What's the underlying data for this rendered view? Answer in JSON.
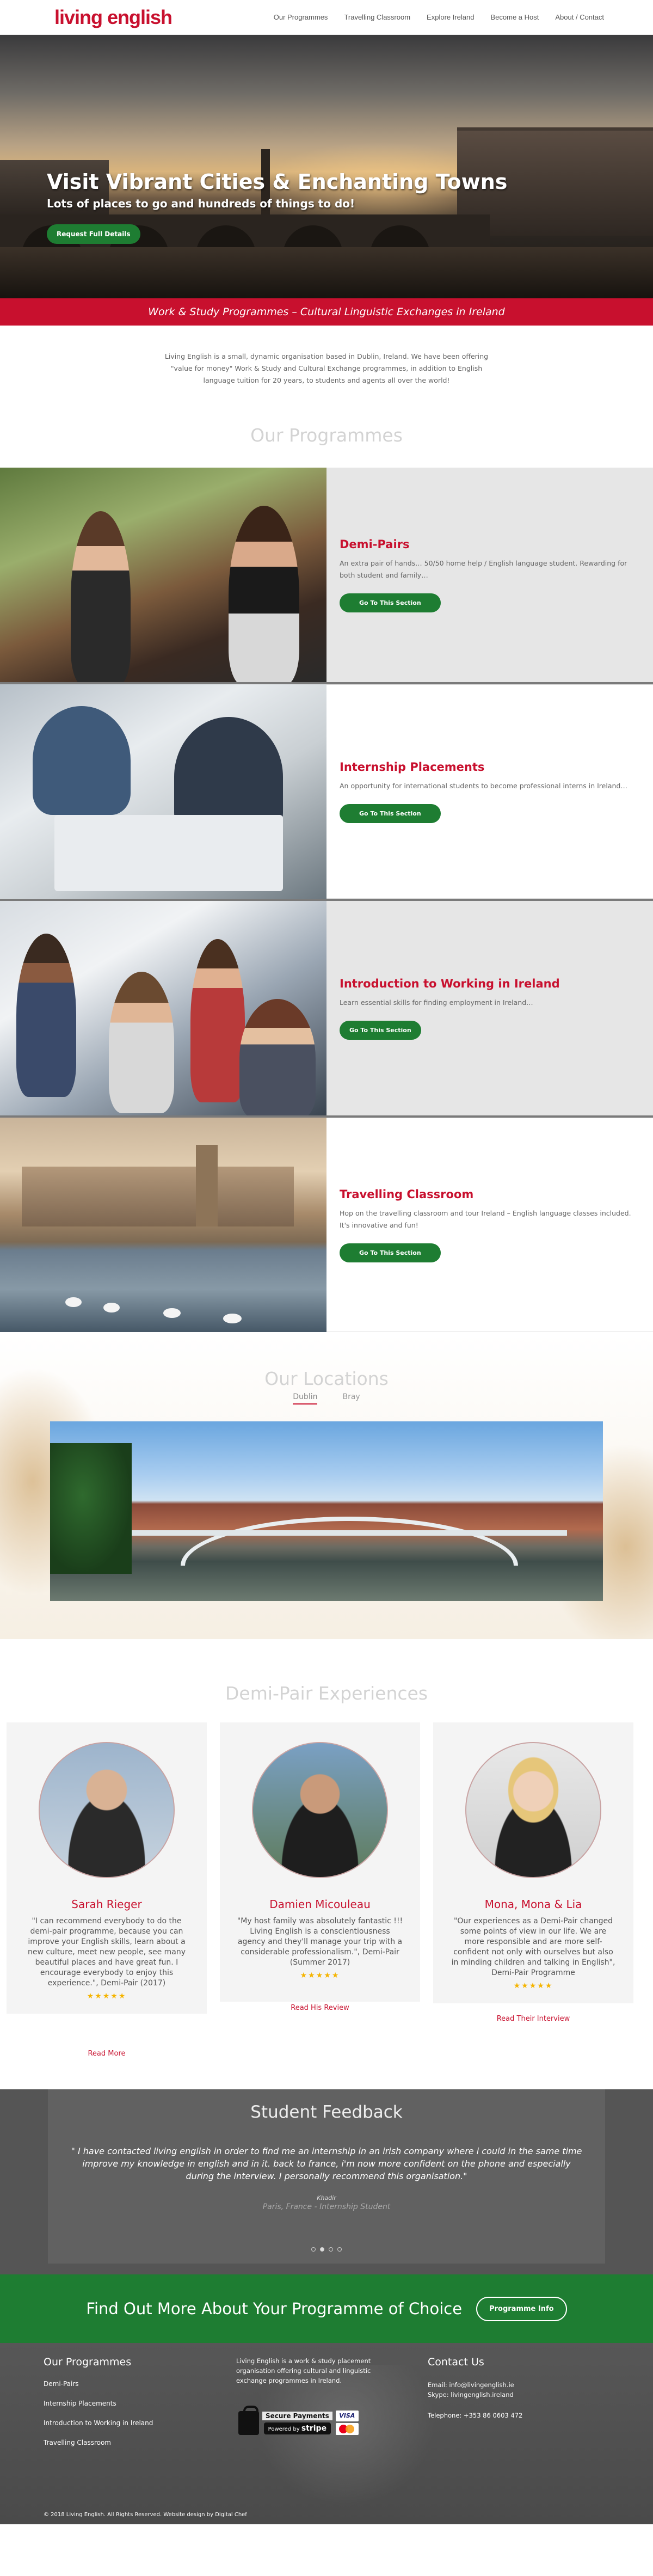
{
  "header": {
    "logo_left": "living ",
    "logo_right": "english",
    "nav": [
      "Our Programmes",
      "Travelling Classroom",
      "Explore Ireland",
      "Become a Host",
      "About / Contact"
    ]
  },
  "hero": {
    "title": "Visit Vibrant Cities & Enchanting Towns",
    "subtitle": "Lots of places to go and hundreds of things to do!",
    "button": "Request Full Details"
  },
  "banner": "Work & Study Programmes – Cultural Linguistic Exchanges in Ireland",
  "intro": "Living English is a small, dynamic organisation based in Dublin, Ireland. We have been offering \"value for money\" Work & Study and Cultural Exchange programmes, in addition to English language tuition for 20 years, to students and agents all over the world!",
  "programmes": {
    "title": "Our Programmes",
    "items": [
      {
        "title": "Demi-Pairs",
        "desc": "An extra pair of hands… 50/50 home help / English language student. Rewarding for both student and family…",
        "button": "Go To This Section"
      },
      {
        "title": "Internship Placements",
        "desc": "An opportunity for international students to become professional interns in Ireland…",
        "button": "Go To This Section"
      },
      {
        "title": "Introduction to Working in Ireland",
        "desc": "Learn essential skills for finding employment in Ireland…",
        "button": "Go To This Section"
      },
      {
        "title": "Travelling Classroom",
        "desc": "Hop on the travelling classroom and tour Ireland – English language classes included. It's innovative and fun!",
        "button": "Go To This Section"
      }
    ]
  },
  "locations": {
    "title": "Our Locations",
    "tabs": [
      "Dublin",
      "Bray"
    ],
    "active_tab": "Dublin"
  },
  "experiences": {
    "title": "Demi-Pair Experiences",
    "cards": [
      {
        "name": "Sarah Rieger",
        "quote": "\"I can recommend everybody to do the demi-pair programme, because you can improve your English skills, learn about a new culture, meet new people, see many beautiful places and have great fun. I encourage everybody to enjoy this experience.\", Demi-Pair (2017)",
        "stars": "★★★★★",
        "link": "Read More"
      },
      {
        "name": "Damien Micouleau",
        "quote": "\"My host family was absolutely fantastic !!! Living English is a conscientiousness agency and they'll manage your trip with a considerable professionalism.\", Demi-Pair (Summer 2017)",
        "stars": "★★★★★",
        "link": "Read His Review"
      },
      {
        "name": "Mona, Mona & Lia",
        "quote": "\"Our experiences as a Demi-Pair changed some points of view in our life. We are more responsible and are more self-confident not only with ourselves but also in minding children and talking in English\", Demi-Pair Programme",
        "stars": "★★★★★",
        "link": "Read Their Interview"
      }
    ]
  },
  "feedback": {
    "title": "Student Feedback",
    "quote": "\" I have contacted living english in order to find me an internship in an irish company where i could in the same time improve my knowledge in english and in it. back to france, i'm now more confident on the phone and especially during the interview. I personally recommend this organisation.\"",
    "author": "Khadir",
    "location": "Paris, France - Internship Student"
  },
  "cta": {
    "text": "Find Out More About Your Programme of Choice",
    "button": "Programme Info"
  },
  "footer": {
    "programmes_title": "Our Programmes",
    "links": [
      "Demi-Pairs",
      "Internship Placements",
      "Introduction to Working in Ireland",
      "Travelling Classroom"
    ],
    "about": "Living English is a work & study placement organisation offering cultural and linguistic exchange programmes in Ireland.",
    "secure_label": "Secure Payments",
    "powered_by": "Powered by",
    "stripe": "stripe",
    "visa": "VISA",
    "contact_title": "Contact Us",
    "email": "Email: info@livingenglish.ie",
    "skype": "Skype: livingenglish.ireland",
    "telephone": "Telephone: +353 86 0603 472",
    "copyright": "© 2018 Living English. All Rights Reserved. Website design by Digital Chef"
  },
  "colors": {
    "brand_red": "#c8102e",
    "brand_green": "#1e7d32"
  }
}
